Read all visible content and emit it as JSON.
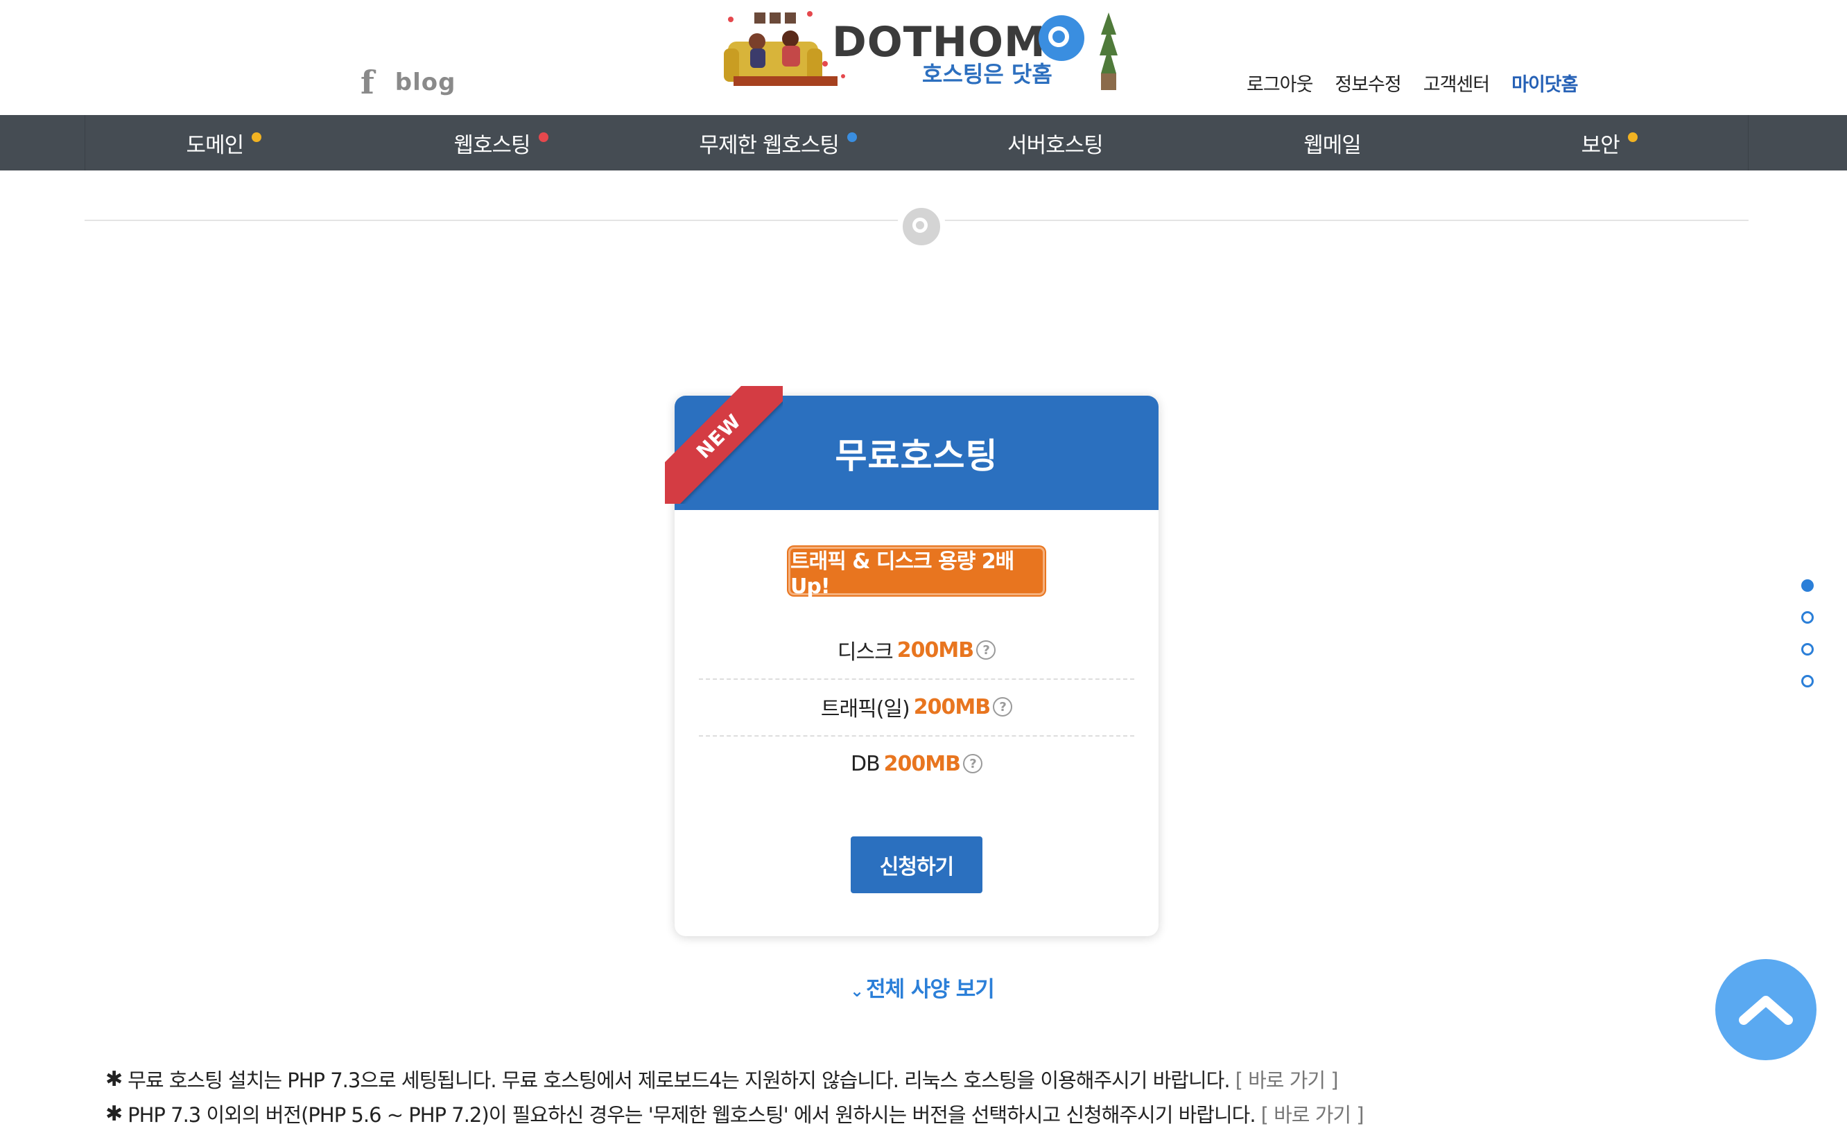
{
  "header": {
    "social": {
      "facebook_glyph": "f",
      "blog_label": "blog"
    },
    "logo": {
      "brand": "DOTHOME",
      "tagline": "호스팅은 닷홈"
    },
    "top_links": [
      "로그아웃",
      "정보수정",
      "고객센터",
      "마이닷홈"
    ]
  },
  "nav": {
    "items": [
      {
        "label": "도메인",
        "dot_color": "#f2b322"
      },
      {
        "label": "웹호스팅",
        "dot_color": "#e5484d"
      },
      {
        "label": "무제한 웹호스팅",
        "dot_color": "#3a8ee0"
      },
      {
        "label": "서버호스팅",
        "dot_color": ""
      },
      {
        "label": "웹메일",
        "dot_color": ""
      },
      {
        "label": "보안",
        "dot_color": "#f2b322"
      }
    ]
  },
  "card": {
    "ribbon": "NEW",
    "title": "무료호스팅",
    "promo": "트래픽 & 디스크 용량 2배 Up!",
    "specs": [
      {
        "label": "디스크",
        "value": "200MB"
      },
      {
        "label": "트래픽(일)",
        "value": "200MB"
      },
      {
        "label": "DB",
        "value": "200MB"
      }
    ],
    "help_glyph": "?",
    "apply_label": "신청하기"
  },
  "fullspec_label": "전체 사양 보기",
  "notes": [
    {
      "text": "무료 호스팅 설치는 PHP 7.3으로 세팅됩니다. 무료 호스팅에서 제로보드4는 지원하지 않습니다. 리눅스 호스팅을 이용해주시기 바랍니다.",
      "link": "[ 바로 가기 ]"
    },
    {
      "text": "PHP 7.3 이외의 버전(PHP 5.6 ~ PHP 7.2)이 필요하신 경우는 '무제한 웹호스팅' 에서 원하시는 버전을 선택하시고 신청해주시기 바랍니다.",
      "link": "[ 바로 가기 ]"
    }
  ],
  "note_marker": "✱",
  "colors": {
    "nav_bg": "#454c53",
    "brand_blue": "#2b70bf",
    "accent_orange": "#e8751f",
    "ribbon_red": "#d43c43",
    "link_blue": "#2b7fd8",
    "totop_blue": "#5aa9f1"
  },
  "icons": {
    "back_to_top": "chevron-up-icon",
    "help": "question-circle-icon"
  }
}
